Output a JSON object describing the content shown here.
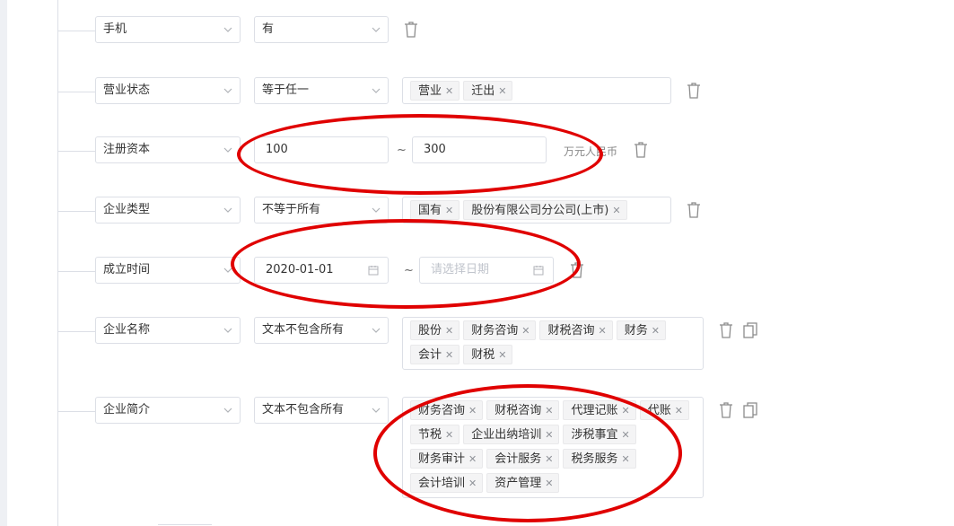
{
  "conditions": [
    {
      "field": "手机",
      "operator": "有"
    },
    {
      "field": "营业状态",
      "operator": "等于任一",
      "tags": [
        "营业",
        "迁出"
      ]
    },
    {
      "field": "注册资本",
      "operator": "",
      "range_from": "100",
      "range_to": "300",
      "separator": "~",
      "unit": "万元人民币"
    },
    {
      "field": "企业类型",
      "operator": "不等于所有",
      "tags": [
        "国有",
        "股份有限公司分公司(上市)"
      ]
    },
    {
      "field": "成立时间",
      "operator": "",
      "range_from": "2020-01-01",
      "range_to_placeholder": "请选择日期",
      "separator": "~"
    },
    {
      "field": "企业名称",
      "operator": "文本不包含所有",
      "tags": [
        "股份",
        "财务咨询",
        "财税咨询",
        "财务",
        "会计",
        "财税"
      ]
    },
    {
      "field": "企业简介",
      "operator": "文本不包含所有",
      "tags": [
        "财务咨询",
        "财税咨询",
        "代理记账",
        "代账",
        "节税",
        "企业出纳培训",
        "涉税事宜",
        "财务审计",
        "会计服务",
        "税务服务",
        "会计培训",
        "资产管理"
      ]
    }
  ],
  "colors": {
    "annotation": "#e00000",
    "border": "#dcdfe6",
    "tag_bg": "#f4f4f5"
  },
  "icons": {
    "delete": "trash-icon",
    "copy": "copy-icon",
    "dropdown": "chevron-down-icon",
    "date": "calendar-icon"
  }
}
